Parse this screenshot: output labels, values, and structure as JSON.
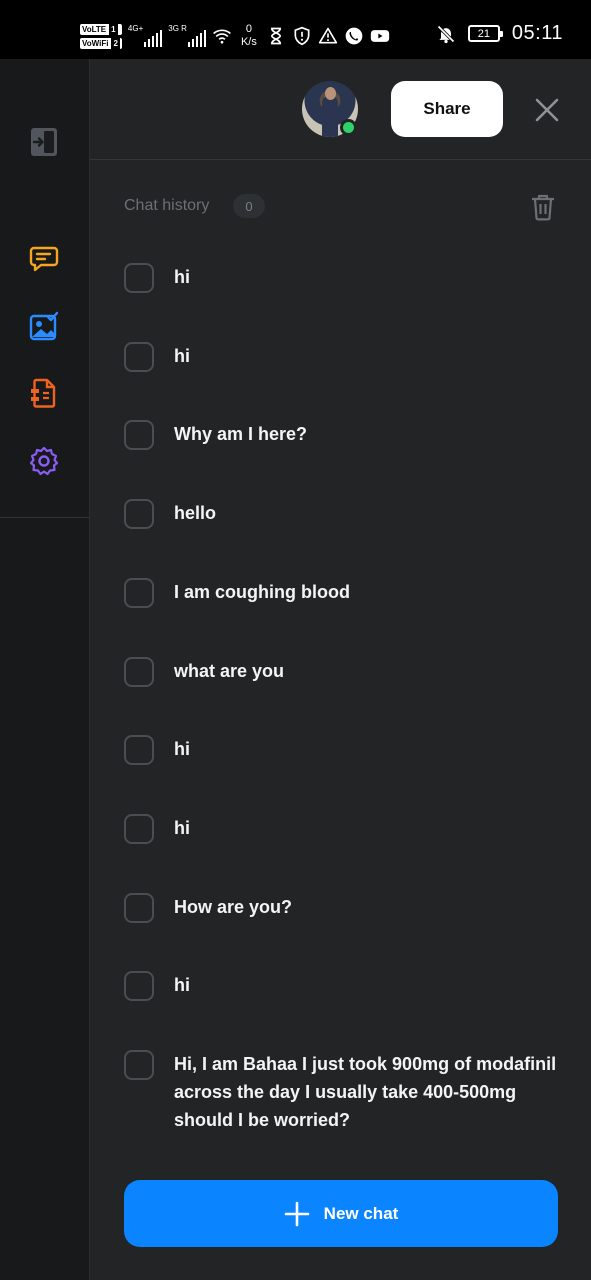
{
  "status_bar": {
    "sim1_label": "VoLTE",
    "sim1_num": "1",
    "sim2_label": "VoWiFi",
    "sim2_num": "2",
    "net1": "4G+",
    "net2": "3G R",
    "speed_value": "0",
    "speed_unit": "K/s",
    "battery": "21",
    "time": "05:11"
  },
  "header": {
    "share_label": "Share"
  },
  "history": {
    "title": "Chat history",
    "count": "0",
    "items": [
      "hi",
      "hi",
      "Why am I here?",
      "hello",
      "I am coughing blood",
      "what are you",
      "hi",
      "hi",
      "How are you?",
      "hi",
      "Hi, I am Bahaa I just took 900mg of modafinil across the day I usually take 400-500mg should I be worried?"
    ]
  },
  "new_chat_label": "New chat",
  "colors": {
    "accent": "#0a84ff",
    "online": "#2fd36a",
    "chat_icon": "#f5a524",
    "image_icon": "#2a8cff",
    "doc_icon": "#f0621f",
    "settings_icon": "#8b5cf6"
  }
}
